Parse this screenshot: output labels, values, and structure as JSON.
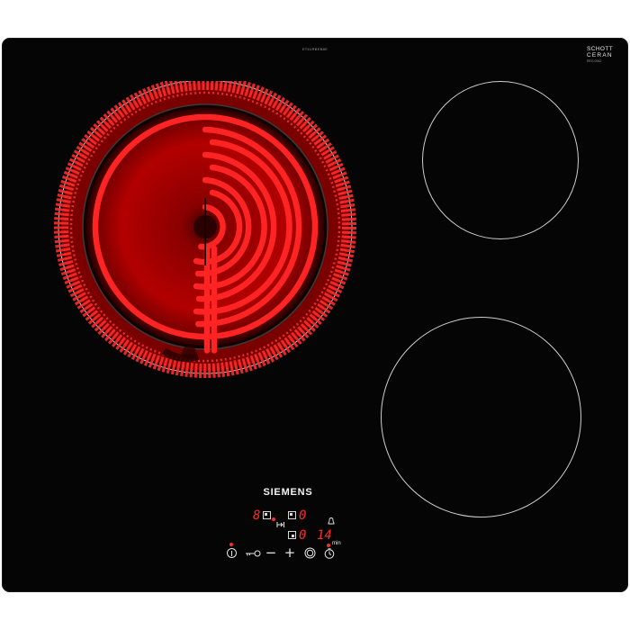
{
  "product": {
    "model_code": "ET61RBEB8E",
    "brand": "SIEMENS",
    "glass_brand_line1": "SCHOTT",
    "glass_brand_line2": "CERAN",
    "glass_code": "REG 0942"
  },
  "zones": [
    {
      "id": "rear-left",
      "state": "heating",
      "glow_color": "#ff1e1e"
    },
    {
      "id": "rear-right",
      "state": "off"
    },
    {
      "id": "front-right",
      "state": "off"
    }
  ],
  "display": {
    "zone_level_main": "8",
    "zone_level_right_top": "0",
    "zone_level_right_bottom": "0",
    "timer_value": "14",
    "timer_unit": "min"
  },
  "controls": {
    "power_icon": "power-icon",
    "childlock_icon": "key-icon",
    "minus_label": "−",
    "plus_label": "+",
    "zone_select_icon": "zone-select-icon",
    "timer_icon": "timer-clock-icon",
    "alarm_icon": "bell-icon",
    "hold_icon": "arrow-to-bar-icon"
  },
  "colors": {
    "glass": "#050505",
    "display_red": "#ff2a2a",
    "print_white": "#e6e6e6"
  }
}
